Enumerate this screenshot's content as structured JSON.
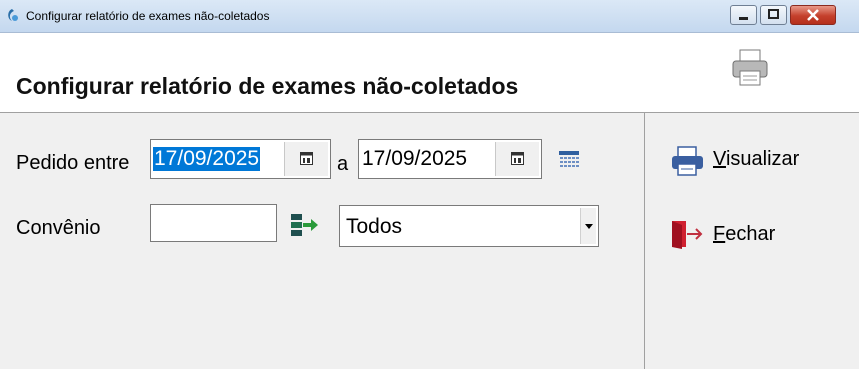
{
  "window": {
    "title": "Configurar relatório de exames não-coletados"
  },
  "header": {
    "title": "Configurar relatório de exames não-coletados"
  },
  "form": {
    "pedido_label": "Pedido entre",
    "date_from": "17/09/2025",
    "between_label": "a",
    "date_to": "17/09/2025",
    "convenio_label": "Convênio",
    "convenio_code": "",
    "convenio_select": "Todos"
  },
  "actions": {
    "visualizar_first": "V",
    "visualizar_rest": "isualizar",
    "fechar_first": "F",
    "fechar_rest": "echar"
  },
  "colors": {
    "selection": "#0078d7",
    "accent_green": "#2a9a3a",
    "accent_red": "#d02030"
  },
  "icons": [
    "app-icon",
    "minimize-icon",
    "maximize-icon",
    "close-icon",
    "printer-icon",
    "calendar-icon",
    "calendar-range-icon",
    "lookup-icon",
    "dropdown-arrow-icon",
    "exit-door-icon"
  ]
}
